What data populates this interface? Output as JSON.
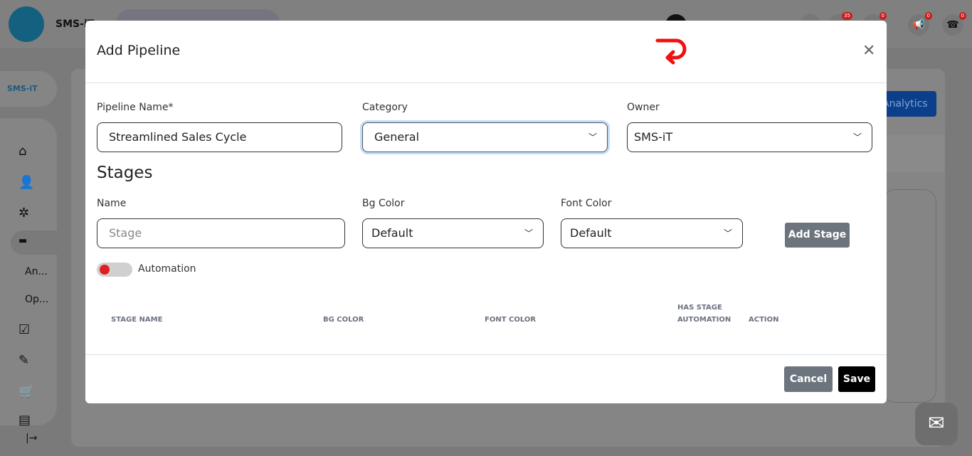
{
  "app": {
    "user_name": "SMS-iT",
    "logo_text": "SMS-iT",
    "badges": {
      "messages": "35",
      "chat": "0",
      "announcements": "0",
      "calls": "0"
    },
    "sidebar": {
      "sub_items": [
        "An...",
        "Op..."
      ]
    },
    "analytics_label": "Analytics"
  },
  "modal": {
    "title": "Add Pipeline",
    "pipeline_name_label": "Pipeline Name*",
    "pipeline_name_value": "Streamlined Sales Cycle",
    "category_label": "Category",
    "category_value": "General",
    "owner_label": "Owner",
    "owner_value": "SMS-iT",
    "stages_heading": "Stages",
    "name_label": "Name",
    "name_placeholder": "Stage",
    "bg_color_label": "Bg Color",
    "bg_color_value": "Default",
    "font_color_label": "Font Color",
    "font_color_value": "Default",
    "add_stage_label": "Add Stage",
    "automation_label": "Automation",
    "automation_enabled": false,
    "table_headers": [
      "STAGE NAME",
      "BG COLOR",
      "FONT COLOR",
      "HAS STAGE AUTOMATION",
      "ACTION"
    ],
    "cancel_label": "Cancel",
    "save_label": "Save"
  },
  "colors": {
    "accent_red": "#e02020",
    "save": "#000000",
    "secondary": "#6c757d"
  }
}
